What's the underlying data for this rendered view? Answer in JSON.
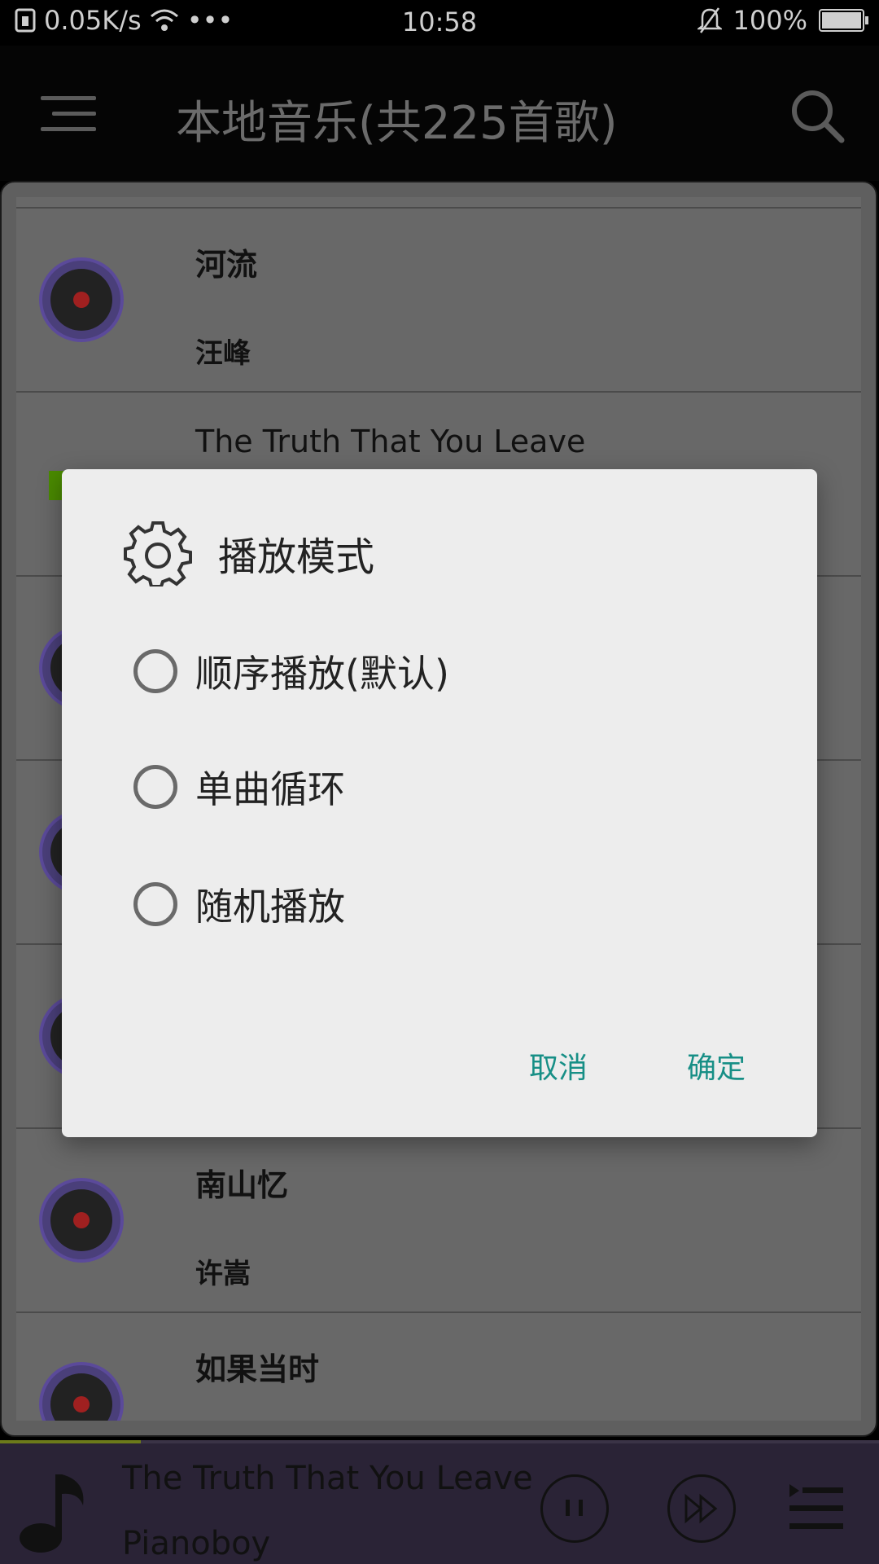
{
  "status_bar": {
    "net_speed": "0.05K/s",
    "more": "•••",
    "time": "10:58",
    "battery": "100%"
  },
  "toolbar": {
    "title": "本地音乐(共225首歌)"
  },
  "list": {
    "items": [
      {
        "song": "河流",
        "artist": "汪峰"
      },
      {
        "song": "The Truth That You Leave",
        "artist": ""
      },
      {
        "song": "",
        "artist": ""
      },
      {
        "song": "",
        "artist": ""
      },
      {
        "song": "",
        "artist": ""
      },
      {
        "song": "南山忆",
        "artist": "许嵩"
      },
      {
        "song": "如果当时",
        "artist": ""
      }
    ]
  },
  "player": {
    "title": "The Truth That You Leave",
    "artist": "Pianoboy",
    "progress": 0.16
  },
  "dialog": {
    "title": "播放模式",
    "options": [
      {
        "label": "顺序播放(默认)",
        "selected": false
      },
      {
        "label": "单曲循环",
        "selected": false
      },
      {
        "label": "随机播放",
        "selected": false
      }
    ],
    "cancel_label": "取消",
    "ok_label": "确定"
  },
  "colors": {
    "accent": "#178f86",
    "player_bg": "#2a2336",
    "disc": "#5b4a9a"
  }
}
